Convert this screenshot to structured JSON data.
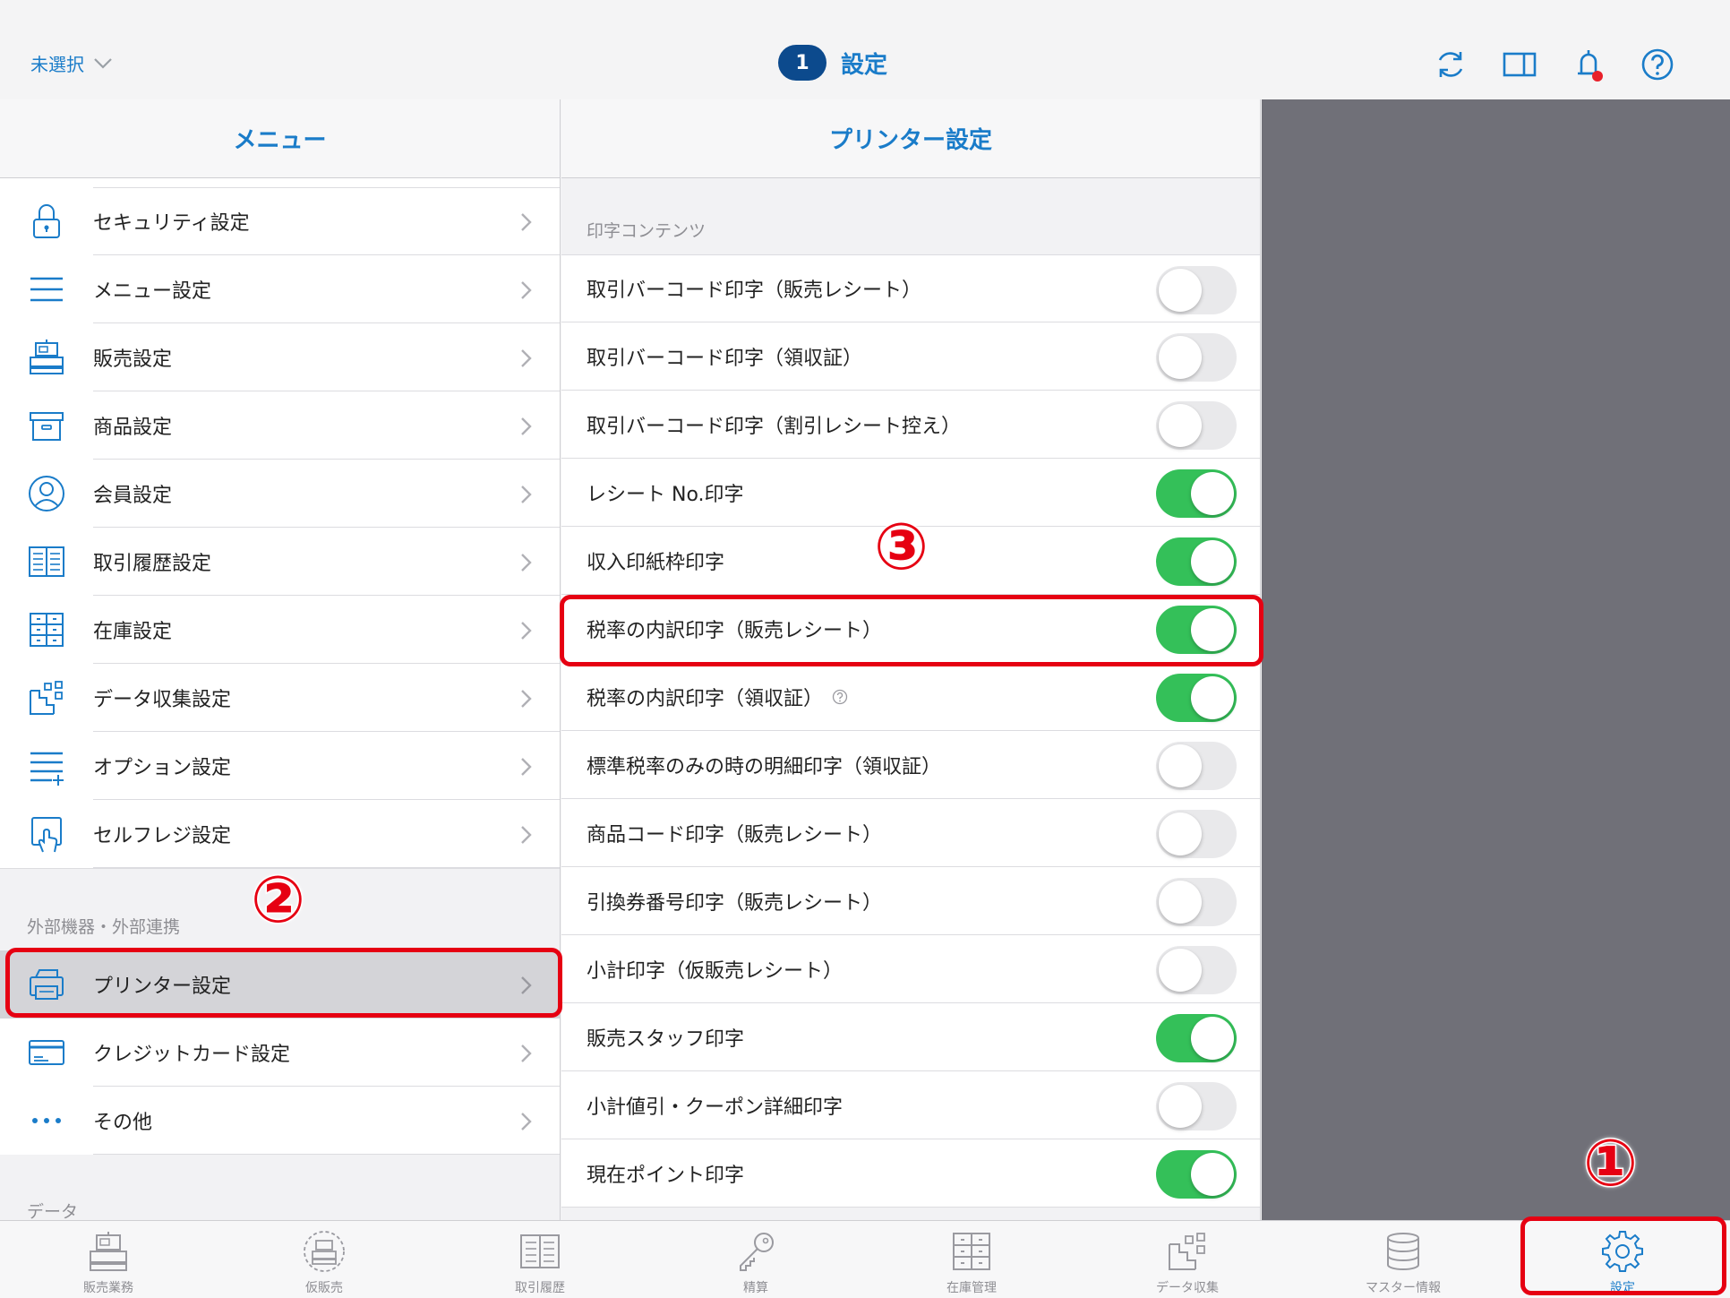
{
  "header": {
    "unselected_label": "未選択",
    "badge_count": "1",
    "title": "設定"
  },
  "menu": {
    "title": "メニュー",
    "items": [
      {
        "label": "セキュリティ設定",
        "icon": "lock-icon"
      },
      {
        "label": "メニュー設定",
        "icon": "hamburger-icon"
      },
      {
        "label": "販売設定",
        "icon": "register-icon"
      },
      {
        "label": "商品設定",
        "icon": "box-icon"
      },
      {
        "label": "会員設定",
        "icon": "user-icon"
      },
      {
        "label": "取引履歴設定",
        "icon": "book-icon"
      },
      {
        "label": "在庫設定",
        "icon": "shelf-icon"
      },
      {
        "label": "データ収集設定",
        "icon": "data-icon"
      },
      {
        "label": "オプション設定",
        "icon": "list-plus-icon"
      },
      {
        "label": "セルフレジ設定",
        "icon": "self-register-icon"
      }
    ],
    "section_external": "外部機器・外部連携",
    "external_items": [
      {
        "label": "プリンター設定",
        "icon": "printer-icon",
        "selected": true
      },
      {
        "label": "クレジットカード設定",
        "icon": "credit-card-icon"
      },
      {
        "label": "その他",
        "icon": "more-icon"
      }
    ],
    "section_data": "データ"
  },
  "printer_settings": {
    "title": "プリンター設定",
    "section_label": "印字コンテンツ",
    "rows": [
      {
        "label": "取引バーコード印字（販売レシート）",
        "on": false
      },
      {
        "label": "取引バーコード印字（領収証）",
        "on": false
      },
      {
        "label": "取引バーコード印字（割引レシート控え）",
        "on": false
      },
      {
        "label": "レシート No.印字",
        "on": true
      },
      {
        "label": "収入印紙枠印字",
        "on": true
      },
      {
        "label": "税率の内訳印字（販売レシート）",
        "on": true
      },
      {
        "label": "税率の内訳印字（領収証）",
        "on": true,
        "help": true
      },
      {
        "label": "標準税率のみの時の明細印字（領収証）",
        "on": false
      },
      {
        "label": "商品コード印字（販売レシート）",
        "on": false
      },
      {
        "label": "引換券番号印字（販売レシート）",
        "on": false
      },
      {
        "label": "小計印字（仮販売レシート）",
        "on": false
      },
      {
        "label": "販売スタッフ印字",
        "on": true
      },
      {
        "label": "小計値引・クーポン詳細印字",
        "on": false
      },
      {
        "label": "現在ポイント印字",
        "on": true
      }
    ]
  },
  "tabs": [
    {
      "label": "販売業務",
      "icon": "register-icon"
    },
    {
      "label": "仮販売",
      "icon": "temp-register-icon"
    },
    {
      "label": "取引履歴",
      "icon": "book-icon"
    },
    {
      "label": "精算",
      "icon": "key-icon"
    },
    {
      "label": "在庫管理",
      "icon": "shelf-icon"
    },
    {
      "label": "データ収集",
      "icon": "data-icon"
    },
    {
      "label": "マスター情報",
      "icon": "database-icon"
    },
    {
      "label": "設定",
      "icon": "gear-icon",
      "active": true
    }
  ],
  "annotations": [
    "①",
    "②",
    "③"
  ],
  "colors": {
    "accent": "#1a7cc9",
    "badge": "#0c4a8d",
    "toggle_on": "#34c059",
    "annotation": "#e60012",
    "dark_area": "#707078"
  }
}
